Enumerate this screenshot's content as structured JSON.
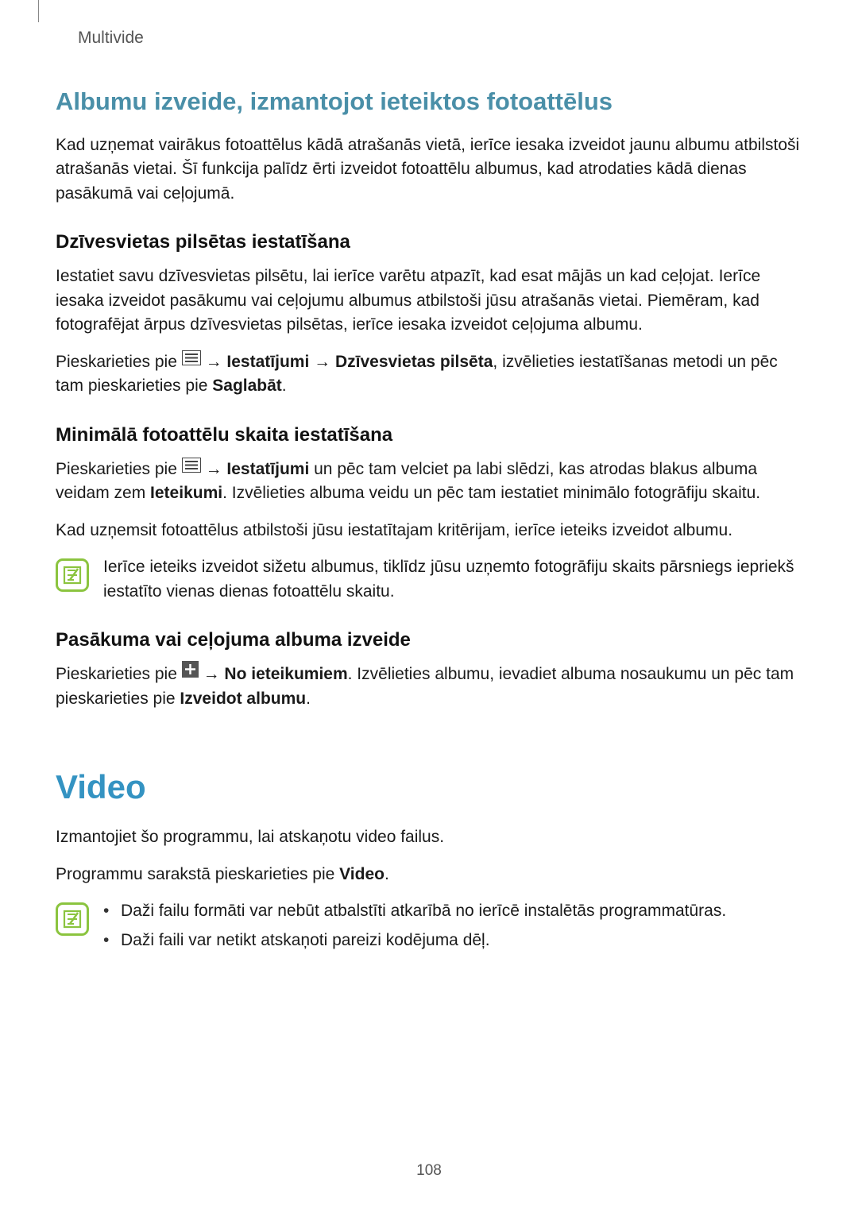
{
  "header": {
    "breadcrumb": "Multivide"
  },
  "section1": {
    "title": "Albumu izveide, izmantojot ieteiktos fotoattēlus",
    "intro": "Kad uzņemat vairākus fotoattēlus kādā atrašanās vietā, ierīce iesaka izveidot jaunu albumu atbilstoši atrašanās vietai. Šī funkcija palīdz ērti izveidot fotoattēlu albumus, kad atrodaties kādā dienas pasākumā vai ceļojumā.",
    "sub1": {
      "title": "Dzīvesvietas pilsētas iestatīšana",
      "p1": "Iestatiet savu dzīvesvietas pilsētu, lai ierīce varētu atpazīt, kad esat mājās un kad ceļojat. Ierīce iesaka izveidot pasākumu vai ceļojumu albumus atbilstoši jūsu atrašanās vietai. Piemēram, kad fotografējat ārpus dzīvesvietas pilsētas, ierīce iesaka izveidot ceļojuma albumu.",
      "p2_pre": "Pieskarieties pie ",
      "p2_arrow1": " → ",
      "p2_bold1": "Iestatījumi",
      "p2_arrow2": " → ",
      "p2_bold2": "Dzīvesvietas pilsēta",
      "p2_after": ", izvēlieties iestatīšanas metodi un pēc tam pieskarieties pie ",
      "p2_bold3": "Saglabāt",
      "p2_end": "."
    },
    "sub2": {
      "title": "Minimālā fotoattēlu skaita iestatīšana",
      "p1_pre": "Pieskarieties pie ",
      "p1_arrow1": " → ",
      "p1_bold1": "Iestatījumi",
      "p1_after1": " un pēc tam velciet pa labi slēdzi, kas atrodas blakus albuma veidam zem ",
      "p1_bold2": "Ieteikumi",
      "p1_after2": ". Izvēlieties albuma veidu un pēc tam iestatiet minimālo fotogrāfiju skaitu.",
      "p2": "Kad uzņemsit fotoattēlus atbilstoši jūsu iestatītajam kritērijam, ierīce ieteiks izveidot albumu.",
      "note": "Ierīce ieteiks izveidot sižetu albumus, tiklīdz jūsu uzņemto fotogrāfiju skaits pārsniegs iepriekš iestatīto vienas dienas fotoattēlu skaitu."
    },
    "sub3": {
      "title": "Pasākuma vai ceļojuma albuma izveide",
      "p1_pre": "Pieskarieties pie ",
      "p1_arrow1": " → ",
      "p1_bold1": "No ieteikumiem",
      "p1_after": ". Izvēlieties albumu, ievadiet albuma nosaukumu un pēc tam pieskarieties pie ",
      "p1_bold2": "Izveidot albumu",
      "p1_end": "."
    }
  },
  "section2": {
    "title": "Video",
    "p1": "Izmantojiet šo programmu, lai atskaņotu video failus.",
    "p2_pre": "Programmu sarakstā pieskarieties pie ",
    "p2_bold": "Video",
    "p2_end": ".",
    "note_items": [
      "Daži failu formāti var nebūt atbalstīti atkarībā no ierīcē instalētās programmatūras.",
      "Daži faili var netikt atskaņoti pareizi kodējuma dēļ."
    ]
  },
  "page_number": "108"
}
